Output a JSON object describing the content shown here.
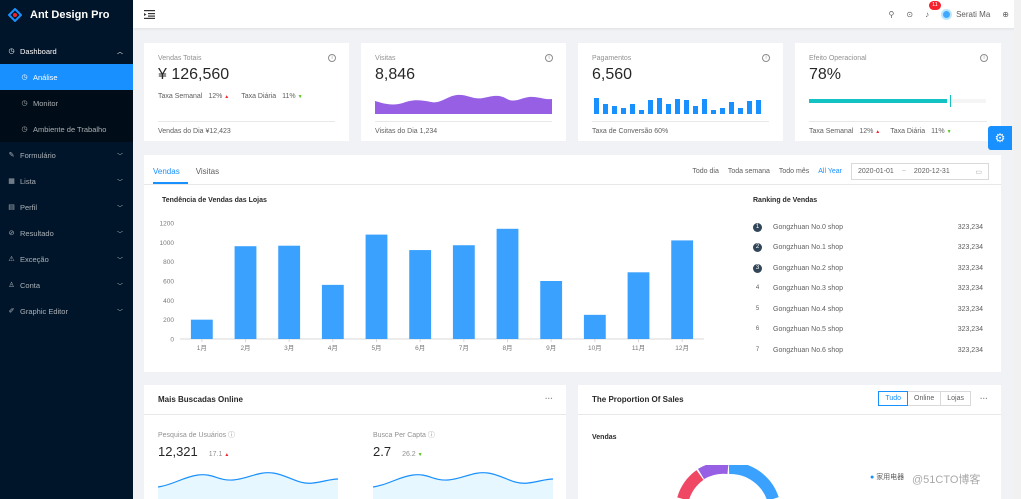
{
  "app": {
    "title": "Ant Design Pro"
  },
  "sidebar": {
    "dashboard": {
      "label": "Dashboard",
      "icon": "dashboard-icon"
    },
    "dashboard_children": [
      {
        "label": "Análise",
        "active": true
      },
      {
        "label": "Monitor",
        "active": false
      },
      {
        "label": "Ambiente de Trabalho",
        "active": false
      }
    ],
    "items": [
      {
        "label": "Formulário",
        "icon": "form-icon"
      },
      {
        "label": "Lista",
        "icon": "table-icon"
      },
      {
        "label": "Perfil",
        "icon": "profile-icon"
      },
      {
        "label": "Resultado",
        "icon": "check-circle-icon"
      },
      {
        "label": "Exceção",
        "icon": "warning-icon"
      },
      {
        "label": "Conta",
        "icon": "user-icon"
      },
      {
        "label": "Graphic Editor",
        "icon": "highlight-icon"
      }
    ]
  },
  "header": {
    "notification_count": "11",
    "user_name": "Serati Ma"
  },
  "stats": {
    "sales": {
      "title": "Vendas Totais",
      "value": "¥ 126,560",
      "weekly_label": "Taxa Semanal",
      "weekly_value": "12%",
      "daily_label": "Taxa Diária",
      "daily_value": "11%",
      "footer": "Vendas do Dia  ¥12,423"
    },
    "visits": {
      "title": "Visitas",
      "value": "8,846",
      "footer": "Visitas do Dia  1,234"
    },
    "payments": {
      "title": "Pagamentos",
      "value": "6,560",
      "footer": "Taxa de Conversão  60%"
    },
    "operational": {
      "title": "Efeito Operacional",
      "value": "78%",
      "progress": 0.78,
      "weekly_label": "Taxa Semanal",
      "weekly_value": "12%",
      "daily_label": "Taxa Diária",
      "daily_value": "11%"
    }
  },
  "sales_card": {
    "tabs": [
      "Vendas",
      "Visitas"
    ],
    "ranges": [
      "Todo dia",
      "Toda semana",
      "Todo mês",
      "All Year"
    ],
    "selected_range": "All Year",
    "date_start": "2020-01-01",
    "date_sep": "~",
    "date_end": "2020-12-31",
    "chart_title": "Tendência de Vendas das Lojas",
    "ranking_title": "Ranking de Vendas",
    "ranking": [
      {
        "rank": "1",
        "name": "Gongzhuan No.0 shop",
        "value": "323,234"
      },
      {
        "rank": "2",
        "name": "Gongzhuan No.1 shop",
        "value": "323,234"
      },
      {
        "rank": "3",
        "name": "Gongzhuan No.2 shop",
        "value": "323,234"
      },
      {
        "rank": "4",
        "name": "Gongzhuan No.3 shop",
        "value": "323,234"
      },
      {
        "rank": "5",
        "name": "Gongzhuan No.4 shop",
        "value": "323,234"
      },
      {
        "rank": "6",
        "name": "Gongzhuan No.5 shop",
        "value": "323,234"
      },
      {
        "rank": "7",
        "name": "Gongzhuan No.6 shop",
        "value": "323,234"
      }
    ]
  },
  "chart_data": {
    "type": "bar",
    "categories": [
      "1月",
      "2月",
      "3月",
      "4月",
      "5月",
      "6月",
      "7月",
      "8月",
      "9月",
      "10月",
      "11月",
      "12月"
    ],
    "values": [
      200,
      960,
      965,
      560,
      1080,
      920,
      970,
      1140,
      600,
      250,
      690,
      1020
    ],
    "yticks": [
      0,
      200,
      400,
      600,
      800,
      1000,
      1200
    ],
    "ylim": [
      0,
      1200
    ],
    "color": "#3ba1ff",
    "xlabel": "",
    "ylabel": ""
  },
  "search_card": {
    "title": "Mais Buscadas Online",
    "users_label": "Pesquisa de Usuários",
    "users_value": "12,321",
    "users_pct": "17.1",
    "per_capita_label": "Busca Per Capta",
    "per_capita_value": "2.7",
    "per_capita_pct": "26.2"
  },
  "proportion_card": {
    "title": "The Proportion Of Sales",
    "segments": [
      "Tudo",
      "Online",
      "Lojas"
    ],
    "selected": "Tudo",
    "subtitle": "Vendas",
    "legend_first": "家用电器"
  },
  "watermark": "@51CTO博客",
  "colors": {
    "primary": "#1890ff",
    "sidebar": "#001529",
    "area": "#975fe4",
    "progress": "#13c2c2"
  }
}
